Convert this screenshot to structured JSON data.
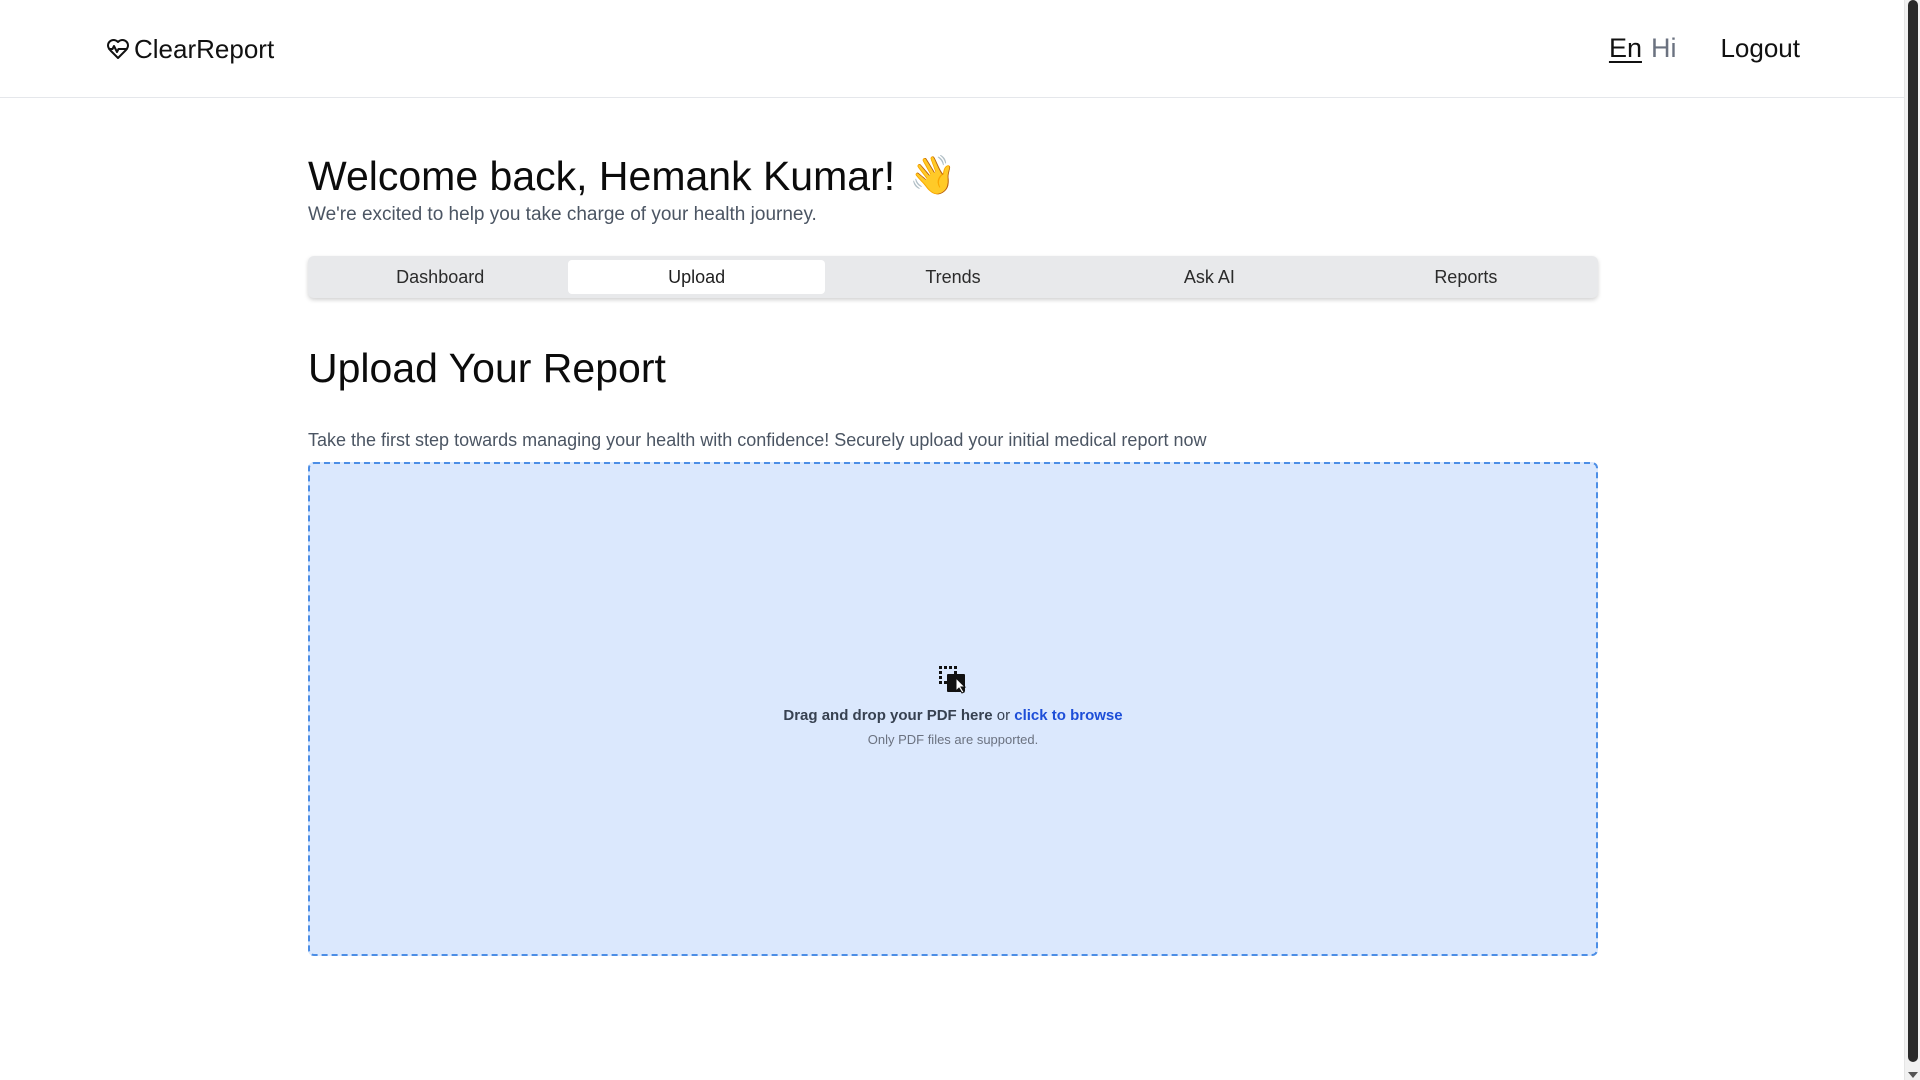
{
  "brand": {
    "name": "ClearReport",
    "icon": "heart-pulse-icon"
  },
  "header": {
    "lang_en": "En",
    "lang_hi": "Hi",
    "logout_label": "Logout"
  },
  "welcome": {
    "title": "Welcome back, Hemank Kumar!",
    "emoji": "👋",
    "subtitle": "We're excited to help you take charge of your health journey."
  },
  "tabs": [
    {
      "label": "Dashboard",
      "active": false
    },
    {
      "label": "Upload",
      "active": true
    },
    {
      "label": "Trends",
      "active": false
    },
    {
      "label": "Ask AI",
      "active": false
    },
    {
      "label": "Reports",
      "active": false
    }
  ],
  "upload": {
    "title": "Upload Your Report",
    "description": "Take the first step towards managing your health with confidence! Securely upload your initial medical report now",
    "drop_text": "Drag and drop your PDF here",
    "or_text": "or",
    "browse_text": "click to browse",
    "note": "Only PDF files are supported.",
    "icon": "drag-drop-icon"
  },
  "colors": {
    "dropzone_bg": "#dbe8fd",
    "dropzone_border": "#4c8ee6",
    "link": "#1d4ed8",
    "tab_bar": "#e8e9eb"
  }
}
